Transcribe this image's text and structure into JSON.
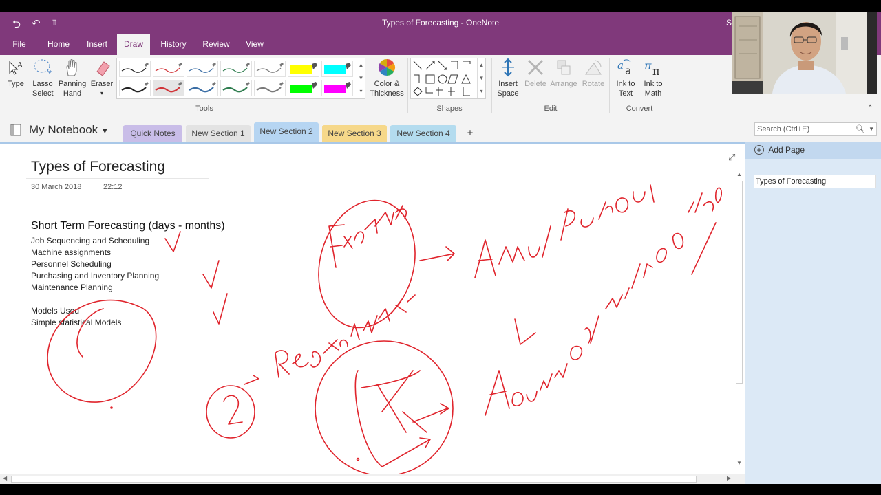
{
  "titlebar": {
    "title": "Types of Forecasting  -  OneNote",
    "signin": "Si",
    "back_icon": "back-arrow-icon",
    "undo_icon": "undo-icon",
    "customize_icon": "customize-quick-access-icon"
  },
  "menu": {
    "tabs": [
      "File",
      "Home",
      "Insert",
      "Draw",
      "History",
      "Review",
      "View"
    ],
    "active": "Draw"
  },
  "ribbon": {
    "type_label": "Type",
    "lasso_label": "Lasso Select",
    "panning_label": "Panning Hand",
    "eraser_label": "Eraser",
    "tools_group": "Tools",
    "color_label": "Color & Thickness",
    "shapes_group": "Shapes",
    "insert_space_label": "Insert Space",
    "delete_label": "Delete",
    "arrange_label": "Arrange",
    "rotate_label": "Rotate",
    "edit_group": "Edit",
    "ink_text_label": "Ink to Text",
    "ink_math_label": "Ink to Math",
    "convert_group": "Convert",
    "pen_colors": [
      "#222222",
      "#d13438",
      "#3b6ea5",
      "#2f7d4f",
      "#7a7a7a",
      "#ffff00",
      "#00ffff",
      "#222222",
      "#d13438",
      "#3b6ea5",
      "#2f7d4f",
      "#7a7a7a",
      "#00ff00",
      "#ff00ff"
    ]
  },
  "notebook": {
    "name": "My Notebook",
    "sections": [
      {
        "label": "Quick Notes",
        "color": "#c9bde8"
      },
      {
        "label": "New Section 1",
        "color": "#e3e3e3"
      },
      {
        "label": "New Section 2",
        "color": "#b6d5f2"
      },
      {
        "label": "New Section 3",
        "color": "#f6d88a"
      },
      {
        "label": "New Section 4",
        "color": "#b4dcef"
      },
      {
        "label": "+",
        "color": "#f3f3f3"
      }
    ],
    "search_placeholder": "Search (Ctrl+E)"
  },
  "page": {
    "title": "Types of Forecasting",
    "date": "30 March 2018",
    "time": "22:12",
    "heading": "Short Term Forecasting (days - months)",
    "lines": [
      "Job Sequencing and Scheduling",
      "Machine assignments",
      "Personnel Scheduling",
      "Purchasing and Inventory Planning",
      "Maintenance Planning"
    ],
    "models_heading": "Models Used",
    "models_line": "Simple statistical Models"
  },
  "pagepane": {
    "add_page": "Add Page",
    "pages": [
      "Types of Forecasting"
    ]
  },
  "ink_color": "#e0242c"
}
